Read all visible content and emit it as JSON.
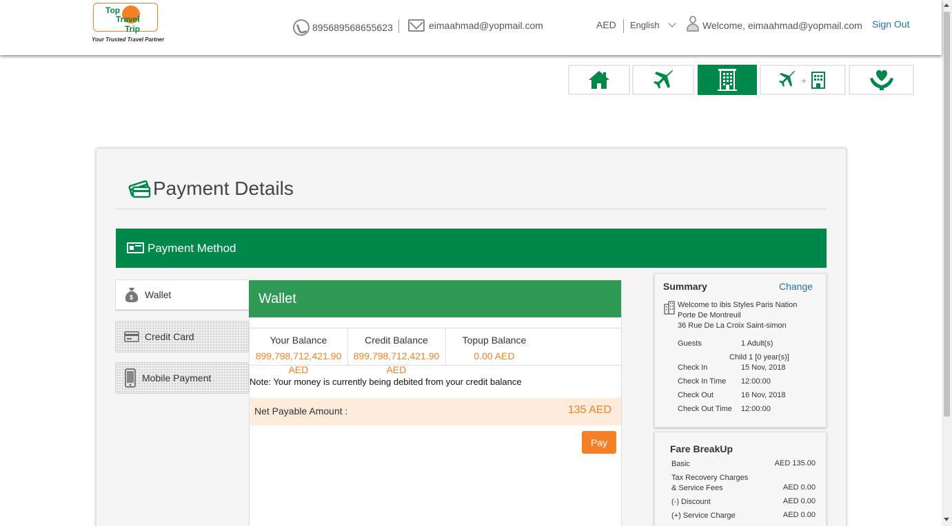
{
  "header": {
    "logo": {
      "line1": "Top",
      "line2": "Travel",
      "line3": "Trip",
      "tagline": "Your Trusted Travel Partner"
    },
    "phone": "895689568655623",
    "email": "eimaahmad@yopmail.com",
    "currency": "AED",
    "language": "English",
    "welcome": "Welcome, eimaahmad@yopmail.com",
    "sign_out": "Sign Out"
  },
  "nav": {
    "items": [
      {
        "icon": "home-icon",
        "active": false
      },
      {
        "icon": "flight-icon",
        "active": false
      },
      {
        "icon": "hotel-icon",
        "active": true
      },
      {
        "icon": "flight-plus-hotel-icon",
        "active": false
      },
      {
        "icon": "holiday-care-icon",
        "active": false
      }
    ]
  },
  "page": {
    "title": "Payment Details"
  },
  "payment_method": {
    "title": "Payment Method",
    "tabs": [
      {
        "label": "Wallet",
        "icon": "money-bag-icon",
        "active": true
      },
      {
        "label": "Credit Card",
        "icon": "credit-card-icon",
        "active": false
      },
      {
        "label": "Mobile Payment",
        "icon": "mobile-phone-icon",
        "active": false
      }
    ]
  },
  "wallet": {
    "title": "Wallet",
    "your_balance_label": "Your Balance",
    "your_balance_value": "899,798,712,421.90",
    "your_balance_currency": "AED",
    "credit_balance_label": "Credit Balance",
    "credit_balance_value": "899,798,712,421.90",
    "credit_balance_currency": "AED",
    "topup_balance_label": "Topup Balance",
    "topup_balance_value": "0.00 AED",
    "note": "Note: Your money is currently being debited from your credit balance",
    "net_payable_label": "Net Payable Amount :",
    "net_payable_value": "135 AED",
    "pay_label": "Pay"
  },
  "summary": {
    "title": "Summary",
    "change": "Change",
    "hotel_line1": "Welcome to ibis Styles Paris Nation",
    "hotel_line2": "Porte De Montreuil",
    "hotel_line3": "36 Rue De La Croix Saint-simon",
    "guests_label": "Guests",
    "guests_value": "1 Adult(s)",
    "child_value": "Child 1 [0 year(s)]",
    "check_in_label": "Check In",
    "check_in_value": "15 Nov, 2018",
    "check_in_time_label": "Check In Time",
    "check_in_time_value": "12:00:00",
    "check_out_label": "Check Out",
    "check_out_value": "16 Nov, 2018",
    "check_out_time_label": "Check Out Time",
    "check_out_time_value": "12:00:00"
  },
  "fare": {
    "title": "Fare BreakUp",
    "basic_label": "Basic",
    "basic_value": "AED 135.00",
    "tax_label_line1": "Tax Recovery Charges",
    "tax_label_line2": "& Service Fees",
    "tax_value": "AED 0.00",
    "discount_label": "(-) Discount",
    "discount_value": "AED 0.00",
    "service_label": "(+) Service Charge",
    "service_value": "AED 0.00"
  },
  "colors": {
    "brand_green": "#00884a",
    "wallet_green": "#2f9a55",
    "accent_orange": "#f58025",
    "link_blue": "#2271b5"
  }
}
